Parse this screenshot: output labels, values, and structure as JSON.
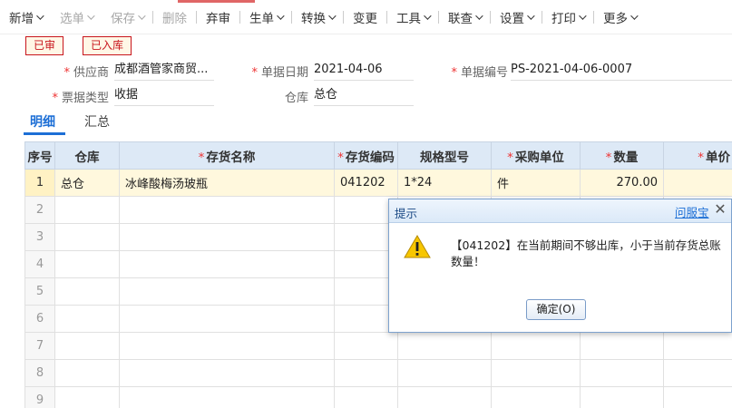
{
  "toolbar": {
    "items": [
      {
        "label": "新增",
        "disabled": false
      },
      {
        "label": "选单",
        "disabled": true
      },
      {
        "label": "保存",
        "disabled": true
      },
      {
        "label": "删除",
        "disabled": true
      },
      {
        "label": "弃审",
        "disabled": false
      },
      {
        "label": "生单",
        "disabled": false
      },
      {
        "label": "转换",
        "disabled": false
      },
      {
        "label": "变更",
        "disabled": false
      },
      {
        "label": "工具",
        "disabled": false
      },
      {
        "label": "联查",
        "disabled": false
      },
      {
        "label": "设置",
        "disabled": false
      },
      {
        "label": "打印",
        "disabled": false
      },
      {
        "label": "更多",
        "disabled": false
      }
    ]
  },
  "status": {
    "audited": "已审",
    "stocked": "已入库"
  },
  "form": {
    "supplier_label": "供应商",
    "supplier_value": "成都酒管家商贸...",
    "date_label": "单据日期",
    "date_value": "2021-04-06",
    "docno_label": "单据编号",
    "docno_value": "PS-2021-04-06-0007",
    "doctype_label": "票据类型",
    "doctype_value": "收据",
    "warehouse_label": "仓库",
    "warehouse_value": "总仓"
  },
  "tabs": [
    {
      "label": "明细",
      "active": true
    },
    {
      "label": "汇总",
      "active": false
    }
  ],
  "grid": {
    "columns": [
      {
        "label": "序号",
        "required": false
      },
      {
        "label": "仓库",
        "required": false
      },
      {
        "label": "存货名称",
        "required": true
      },
      {
        "label": "存货编码",
        "required": true
      },
      {
        "label": "规格型号",
        "required": false
      },
      {
        "label": "采购单位",
        "required": true
      },
      {
        "label": "数量",
        "required": true
      },
      {
        "label": "单价",
        "required": true
      }
    ],
    "rows": [
      {
        "no": "1",
        "warehouse": "总仓",
        "name": "冰峰酸梅汤玻瓶",
        "code": "041202",
        "spec": "1*24",
        "unit": "件",
        "qty": "270.00",
        "price": ""
      },
      {
        "no": "2"
      },
      {
        "no": "3"
      },
      {
        "no": "4"
      },
      {
        "no": "5"
      },
      {
        "no": "6"
      },
      {
        "no": "7"
      },
      {
        "no": "8"
      },
      {
        "no": "9"
      }
    ]
  },
  "dialog": {
    "title": "提示",
    "help_link": "问服宝",
    "close_glyph": "✕",
    "message": "【041202】在当前期间不够出库，小于当前存货总账数量！",
    "ok_button": "确定(O)"
  }
}
